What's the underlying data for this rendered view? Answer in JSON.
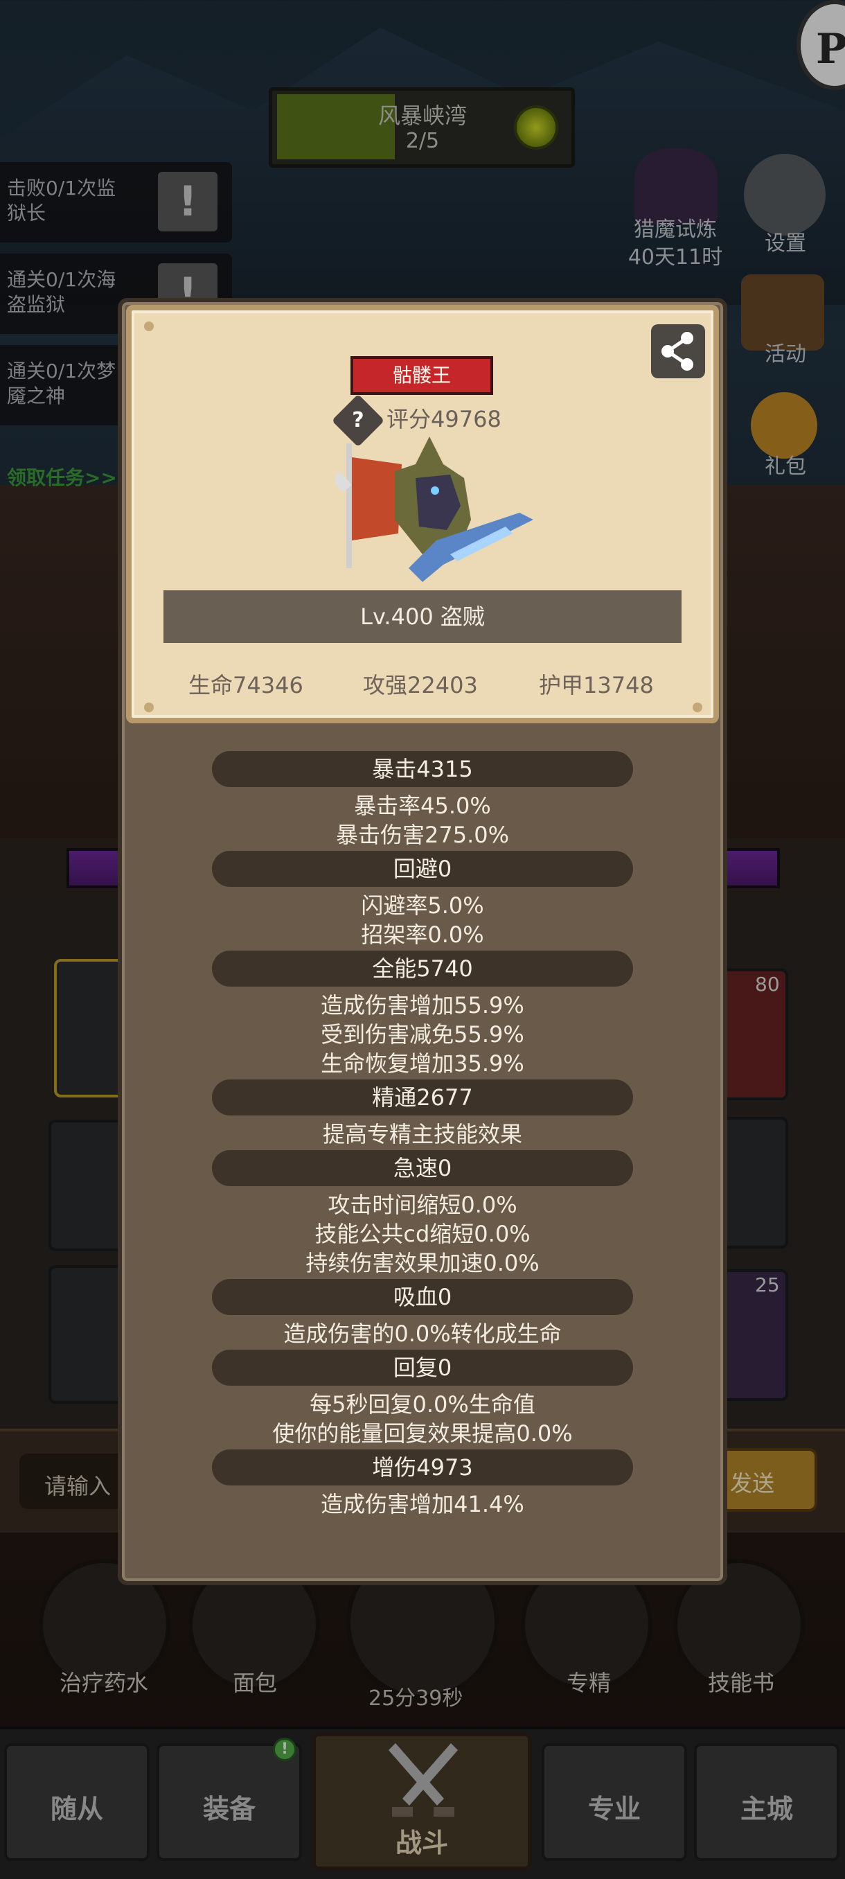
{
  "scene": {
    "zone": {
      "name": "风暴峡湾",
      "progress": "2/5"
    },
    "corner_badge_text": "P",
    "quests": [
      {
        "line1": "击败0/1次监",
        "line2": "狱长"
      },
      {
        "line1": "通关0/1次海",
        "line2": "盗监狱"
      },
      {
        "line1": "通关0/1次梦",
        "line2": "魇之神"
      }
    ],
    "quest_claim": "领取任务>>",
    "side_buttons": {
      "event": {
        "label": "猎魔试炼",
        "sub": "40天11时"
      },
      "settings": "设置",
      "activity": "活动",
      "gift": "礼包"
    },
    "slot_numbers": [
      "80",
      "25"
    ],
    "chat": {
      "placeholder": "请输入",
      "send": "发送"
    },
    "skills": [
      {
        "label": "治疗药水",
        "icon": "potion-icon"
      },
      {
        "label": "面包",
        "icon": "bread-icon"
      },
      {
        "label": "专精",
        "icon": "specialization-icon"
      },
      {
        "label": "技能书",
        "icon": "skillbook-icon"
      }
    ],
    "timer": "25分39秒",
    "tabs": [
      "随从",
      "装备",
      "战斗",
      "专业",
      "主城"
    ],
    "equip_badge": "!"
  },
  "modal": {
    "boss_name": "骷髅王",
    "help_icon": "?",
    "score": "评分49768",
    "level_class": "Lv.400 盗贼",
    "main_stats": [
      "生命74346",
      "攻强22403",
      "护甲13748"
    ],
    "sections": [
      {
        "header": "暴击4315",
        "lines": [
          "暴击率45.0%",
          "暴击伤害275.0%"
        ]
      },
      {
        "header": "回避0",
        "lines": [
          "闪避率5.0%",
          "招架率0.0%"
        ]
      },
      {
        "header": "全能5740",
        "lines": [
          "造成伤害增加55.9%",
          "受到伤害减免55.9%",
          "生命恢复增加35.9%"
        ]
      },
      {
        "header": "精通2677",
        "lines": [
          "提高专精主技能效果"
        ]
      },
      {
        "header": "急速0",
        "lines": [
          "攻击时间缩短0.0%",
          "技能公共cd缩短0.0%",
          "持续伤害效果加速0.0%"
        ]
      },
      {
        "header": "吸血0",
        "lines": [
          "造成伤害的0.0%转化成生命"
        ]
      },
      {
        "header": "回复0",
        "lines": [
          "每5秒回复0.0%生命值",
          "使你的能量回复效果提高0.0%"
        ]
      },
      {
        "header": "增伤4973",
        "lines": [
          "造成伤害增加41.4%"
        ]
      }
    ]
  }
}
